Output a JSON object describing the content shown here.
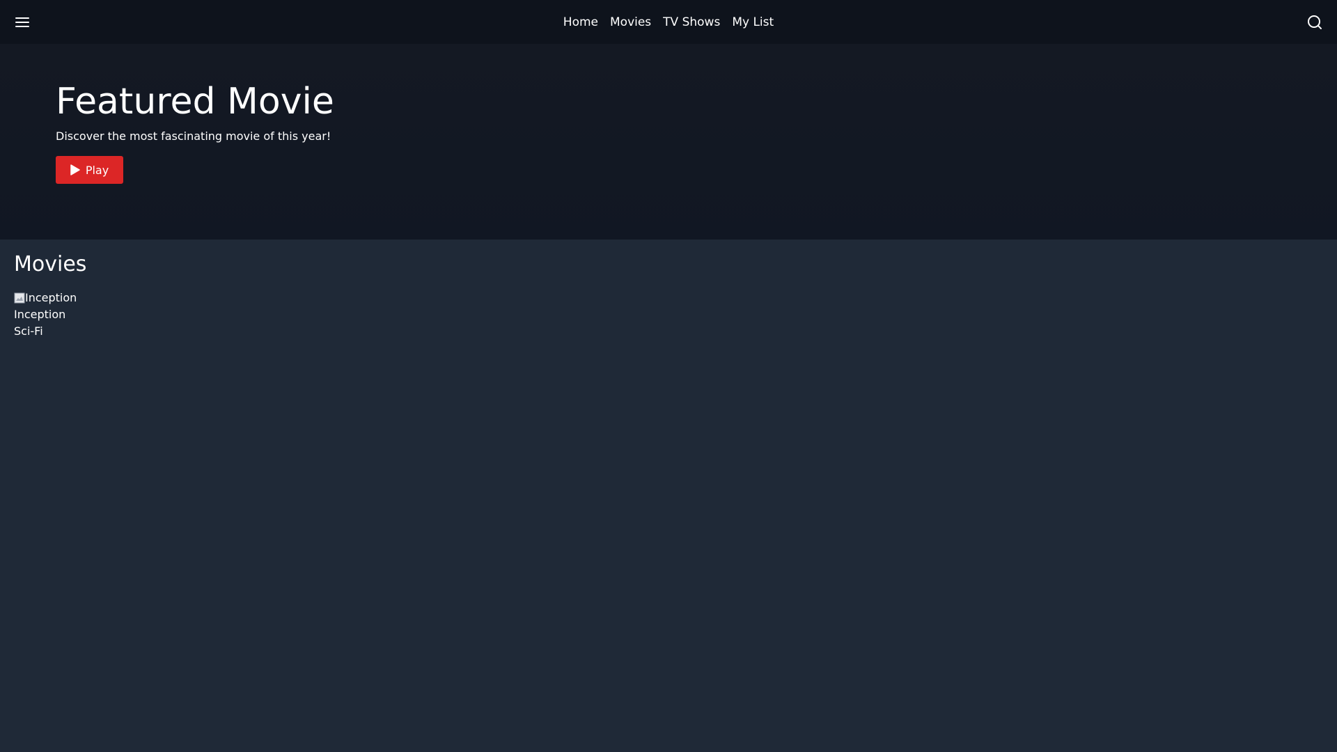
{
  "nav": {
    "links": [
      "Home",
      "Movies",
      "TV Shows",
      "My List"
    ]
  },
  "hero": {
    "title": "Featured Movie",
    "description": "Discover the most fascinating movie of this year!",
    "play_label": "Play"
  },
  "section": {
    "title": "Movies",
    "items": [
      {
        "poster_alt": "Inception",
        "title": "Inception",
        "genre": "Sci-Fi"
      }
    ]
  },
  "colors": {
    "accent": "#dc2626",
    "background": "#1f2937",
    "hero_background": "#111723",
    "topbar_background": "#0e131c"
  },
  "icons": {
    "menu": "menu-icon",
    "search": "search-icon",
    "play": "play-icon",
    "broken_image": "broken-image-icon"
  }
}
